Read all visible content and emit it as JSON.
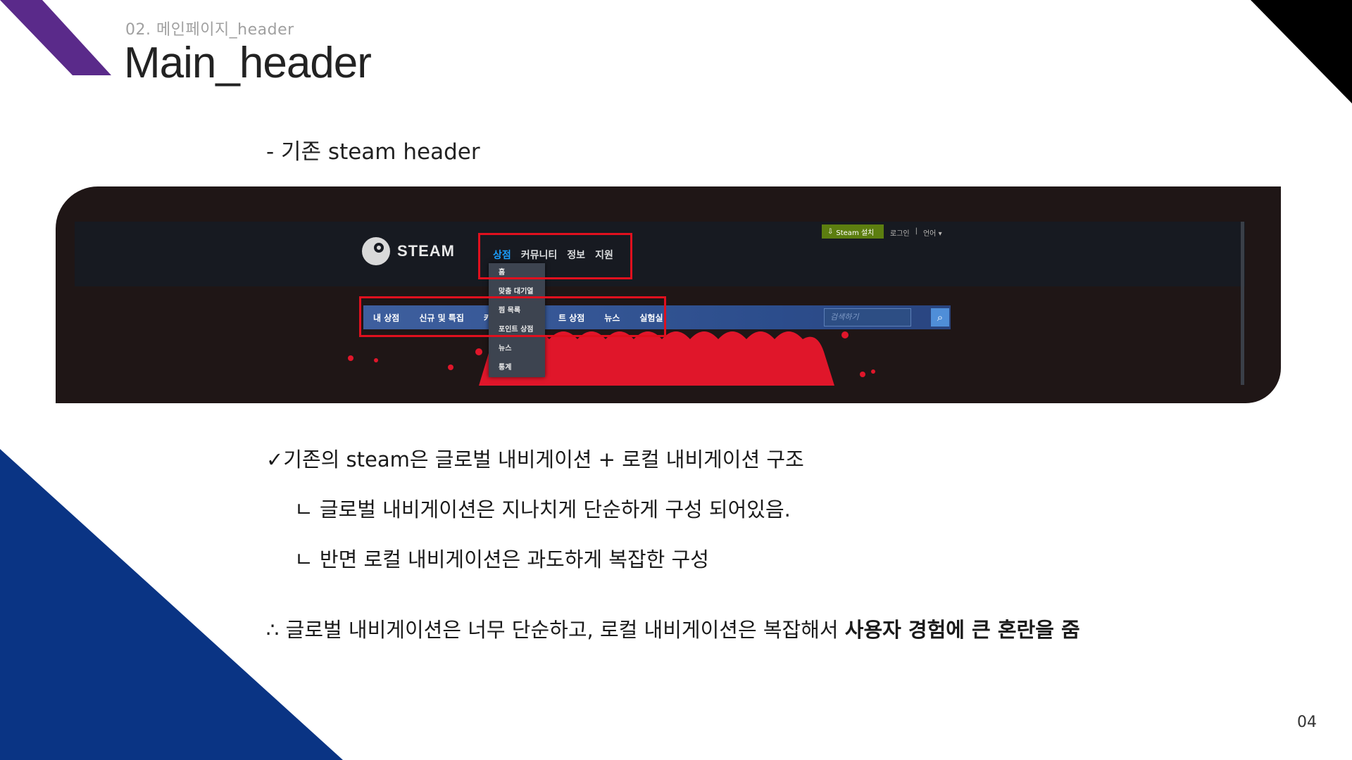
{
  "header": {
    "subtitle": "02. 메인페이지_header",
    "title": "Main_header",
    "intro": "- 기존 steam header"
  },
  "steam_screenshot": {
    "logo_text": "STEAM",
    "gnb": [
      "상점",
      "커뮤니티",
      "정보",
      "지원"
    ],
    "install_button": "Steam 설치",
    "util_links": [
      "로그인",
      "|",
      "언어 ▾"
    ],
    "lnb": [
      "내 상점",
      "신규 및 특집",
      "카테",
      "트 상점",
      "뉴스",
      "실험실"
    ],
    "search_placeholder": "검색하기",
    "dropdown": [
      "홈",
      "맞춤 대기열",
      "찜 목록",
      "포인트 상점",
      "뉴스",
      "통계"
    ]
  },
  "bullets": {
    "b1": "✓기존의 steam은 글로벌 내비게이션 + 로컬 내비게이션 구조",
    "b2": "ㄴ 글로벌 내비게이션은 지나치게 단순하게 구성 되어있음.",
    "b3": "ㄴ 반면 로컬 내비게이션은 과도하게 복잡한 구성",
    "b4_normal": "∴ 글로벌 내비게이션은 너무 단순하고, 로컬 내비게이션은 복잡해서 ",
    "b4_bold": "사용자 경험에 큰 혼란을 줌"
  },
  "page_number": "04",
  "colors": {
    "purple": "#5a2a8a",
    "navy": "#0a3484",
    "black": "#000000",
    "highlight_red": "#e0101e",
    "steam_blue": "#1a9fff",
    "steam_green": "#5c7e10"
  }
}
